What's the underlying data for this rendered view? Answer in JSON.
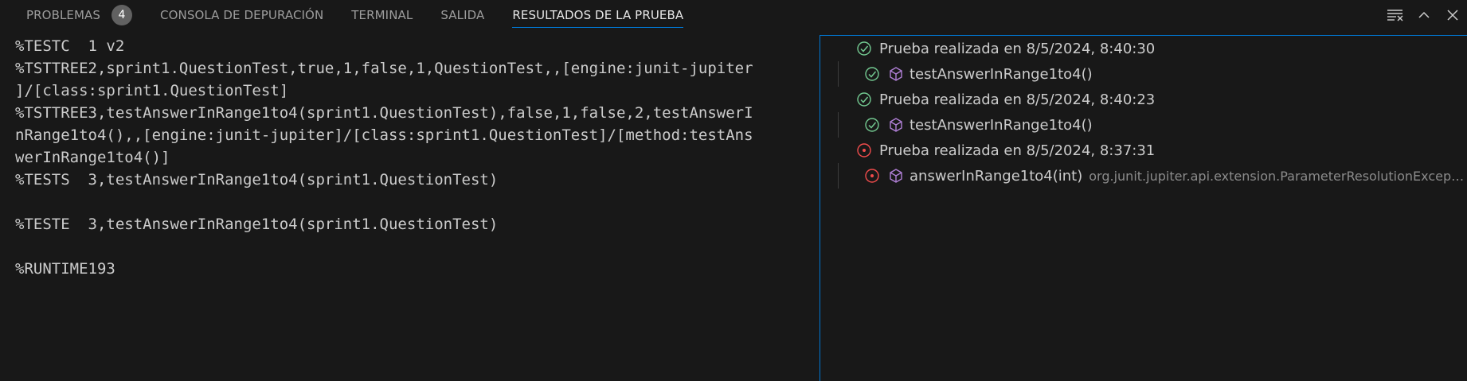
{
  "tabs": [
    {
      "label": "PROBLEMAS",
      "badge": "4"
    },
    {
      "label": "CONSOLA DE DEPURACIÓN"
    },
    {
      "label": "TERMINAL"
    },
    {
      "label": "SALIDA"
    },
    {
      "label": "RESULTADOS DE LA PRUEBA",
      "active": true
    }
  ],
  "actions": [
    {
      "icon": "clear-output-icon"
    },
    {
      "icon": "chevron-up-icon"
    },
    {
      "icon": "close-icon"
    }
  ],
  "output_lines": [
    "%TESTC  1 v2",
    "%TSTTREE2,sprint1.QuestionTest,true,1,false,1,QuestionTest,,[engine:junit-jupiter",
    "]/[class:sprint1.QuestionTest]",
    "%TSTTREE3,testAnswerInRange1to4(sprint1.QuestionTest),false,1,false,2,testAnswerI",
    "nRange1to4(),,[engine:junit-jupiter]/[class:sprint1.QuestionTest]/[method:testAns",
    "werInRange1to4()]",
    "%TESTS  3,testAnswerInRange1to4(sprint1.QuestionTest)",
    "",
    "%TESTE  3,testAnswerInRange1to4(sprint1.QuestionTest)",
    "",
    "%RUNTIME193"
  ],
  "results": [
    {
      "level": 1,
      "status": "passed",
      "label": "Prueba realizada en 8/5/2024, 8:40:30"
    },
    {
      "level": 2,
      "status": "passed",
      "label": "testAnswerInRange1to4()",
      "description": ""
    },
    {
      "level": 1,
      "status": "passed",
      "label": "Prueba realizada en 8/5/2024, 8:40:23"
    },
    {
      "level": 2,
      "status": "passed",
      "label": "testAnswerInRange1to4()",
      "description": ""
    },
    {
      "level": 1,
      "status": "errored",
      "label": "Prueba realizada en 8/5/2024, 8:37:31"
    },
    {
      "level": 2,
      "status": "errored",
      "label": "answerInRange1to4(int)",
      "description": "org.junit.jupiter.api.extension.ParameterResolutionExceptio..."
    }
  ],
  "colors": {
    "accent": "#0078d4",
    "passed": "#73c991",
    "errored": "#f14c4c",
    "method_icon": "#b180d7"
  }
}
